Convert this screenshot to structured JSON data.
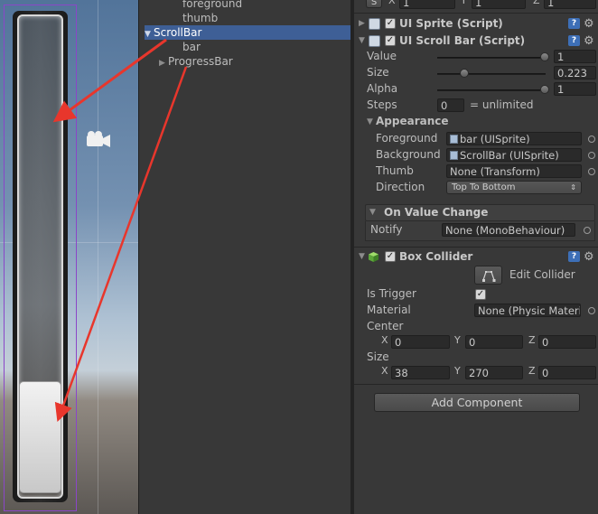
{
  "hierarchy": {
    "items": [
      {
        "label": "foreground",
        "expanded": null,
        "selected": false
      },
      {
        "label": "thumb",
        "expanded": null,
        "selected": false
      },
      {
        "label": "ScrollBar",
        "expanded": true,
        "selected": true
      },
      {
        "label": "bar",
        "expanded": null,
        "selected": false
      },
      {
        "label": "ProgressBar",
        "expanded": false,
        "selected": false
      }
    ]
  },
  "inspector": {
    "top_strip": {
      "label_s": "S",
      "x_label": "X",
      "x_value": "1",
      "y_label": "Y",
      "y_value": "1",
      "z_label": "Z",
      "z_value": "1"
    },
    "ui_sprite": {
      "title": "UI Sprite (Script)",
      "enabled": true
    },
    "ui_scroll_bar": {
      "title": "UI Scroll Bar (Script)",
      "enabled": true,
      "value_label": "Value",
      "value": "1",
      "value_fraction": 1.0,
      "size_label": "Size",
      "size": "0.223",
      "size_fraction": 0.223,
      "alpha_label": "Alpha",
      "alpha": "1",
      "alpha_fraction": 1.0,
      "steps_label": "Steps",
      "steps": "0",
      "steps_note": "= unlimited",
      "appearance_label": "Appearance",
      "foreground_label": "Foreground",
      "foreground_value": "bar (UISprite)",
      "background_label": "Background",
      "background_value": "ScrollBar (UISprite)",
      "thumb_label": "Thumb",
      "thumb_value": "None (Transform)",
      "direction_label": "Direction",
      "direction_value": "Top To Bottom",
      "on_value_change_label": "On Value Change",
      "notify_label": "Notify",
      "notify_value": "None (MonoBehaviour)"
    },
    "box_collider": {
      "title": "Box Collider",
      "enabled": true,
      "edit_collider_label": "Edit Collider",
      "is_trigger_label": "Is Trigger",
      "is_trigger": true,
      "material_label": "Material",
      "material_value": "None (Physic Materi",
      "center_label": "Center",
      "center": {
        "x_label": "X",
        "x": "0",
        "y_label": "Y",
        "y": "0",
        "z_label": "Z",
        "z": "0"
      },
      "size_label": "Size",
      "size": {
        "x_label": "X",
        "x": "38",
        "y_label": "Y",
        "y": "270",
        "z_label": "Z",
        "z": "0"
      }
    },
    "add_component_label": "Add Component"
  },
  "colors": {
    "selection": "#3e5f96",
    "annotation_arrow": "#e8362c",
    "selection_rect": "#8b46c8"
  },
  "icons": [
    "camera-icon",
    "script-icon",
    "help-icon",
    "gear-icon",
    "cube-icon",
    "object-picker-icon",
    "edit-collider-icon"
  ]
}
